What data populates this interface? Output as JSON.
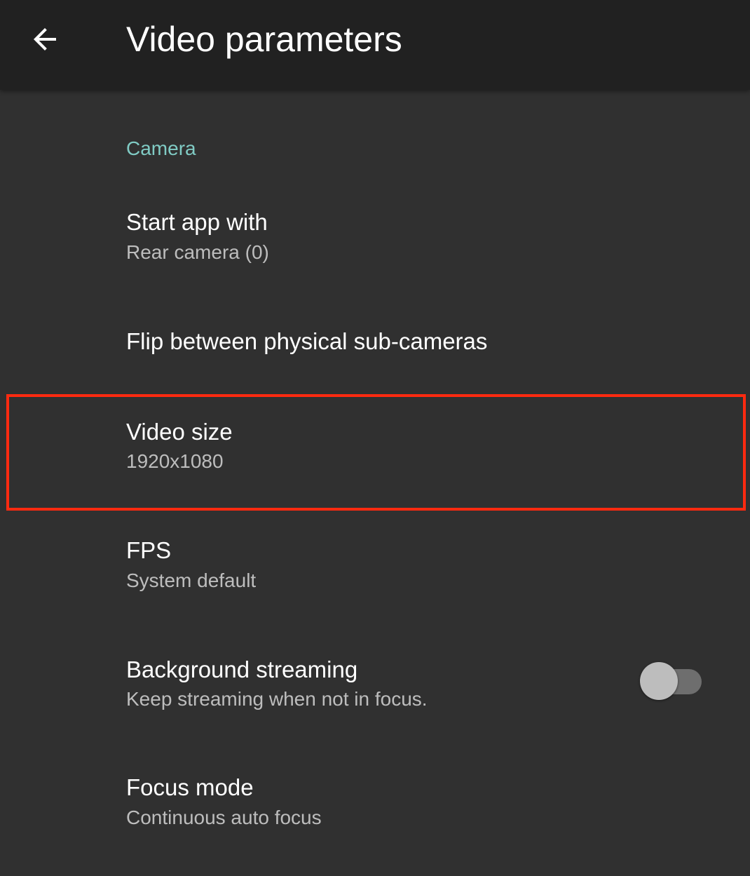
{
  "appbar": {
    "title": "Video parameters",
    "back_icon": "arrow-left-icon"
  },
  "category": {
    "label": "Camera"
  },
  "preferences": [
    {
      "title": "Start app with",
      "summary": "Rear camera (0)"
    },
    {
      "title": "Flip between physical sub-cameras",
      "summary": ""
    },
    {
      "title": "Video size",
      "summary": "1920x1080"
    },
    {
      "title": "FPS",
      "summary": "System default"
    },
    {
      "title": "Background streaming",
      "summary": "Keep streaming when not in focus.",
      "toggle_on": false
    },
    {
      "title": "Focus mode",
      "summary": "Continuous auto focus"
    }
  ],
  "colors": {
    "accent": "#80cbc4",
    "highlight": "#ff2a10",
    "background": "#303030",
    "appbar": "#212121"
  }
}
